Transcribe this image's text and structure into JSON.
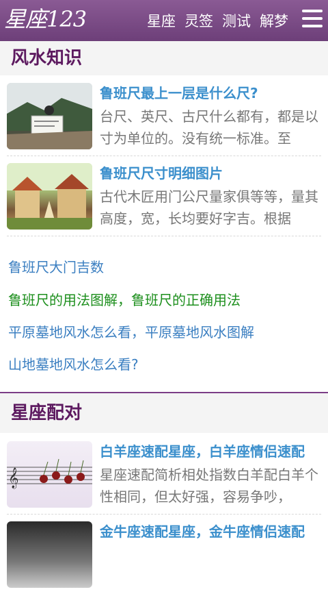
{
  "header": {
    "logo": "星座123",
    "nav": [
      "星座",
      "灵签",
      "测试",
      "解梦"
    ]
  },
  "section1": {
    "title": "风水知识",
    "articles": [
      {
        "title": "鲁班尺最上一层是什么尺?",
        "desc": "台尺、英尺、古尺什么都有，都是以寸为单位的。没有统一标准。至"
      },
      {
        "title": "鲁班尺尺寸明细图片",
        "desc": "古代木匠用门公尺量家俱等等，量其高度，宽，长均要好字吉。根据"
      }
    ],
    "links": [
      "鲁班尺大门吉数",
      "鲁班尺的用法图解，鲁班尺的正确用法",
      "平原墓地风水怎么看，平原墓地风水图解",
      "山地墓地风水怎么看?"
    ]
  },
  "section2": {
    "title": "星座配对",
    "articles": [
      {
        "title": "白羊座速配星座，白羊座情侣速配",
        "desc": "星座速配简析相处指数白羊配白羊个性相同，但太好强，容易争吵，"
      },
      {
        "title": "金牛座速配星座，金牛座情侣速配",
        "desc": ""
      }
    ]
  },
  "colors": {
    "header_bg": "#7a4a86",
    "section_title": "#5d1a60",
    "article_title": "#3b8fcc",
    "link_blue": "#3b7fc1",
    "link_green": "#1d8f1d"
  }
}
